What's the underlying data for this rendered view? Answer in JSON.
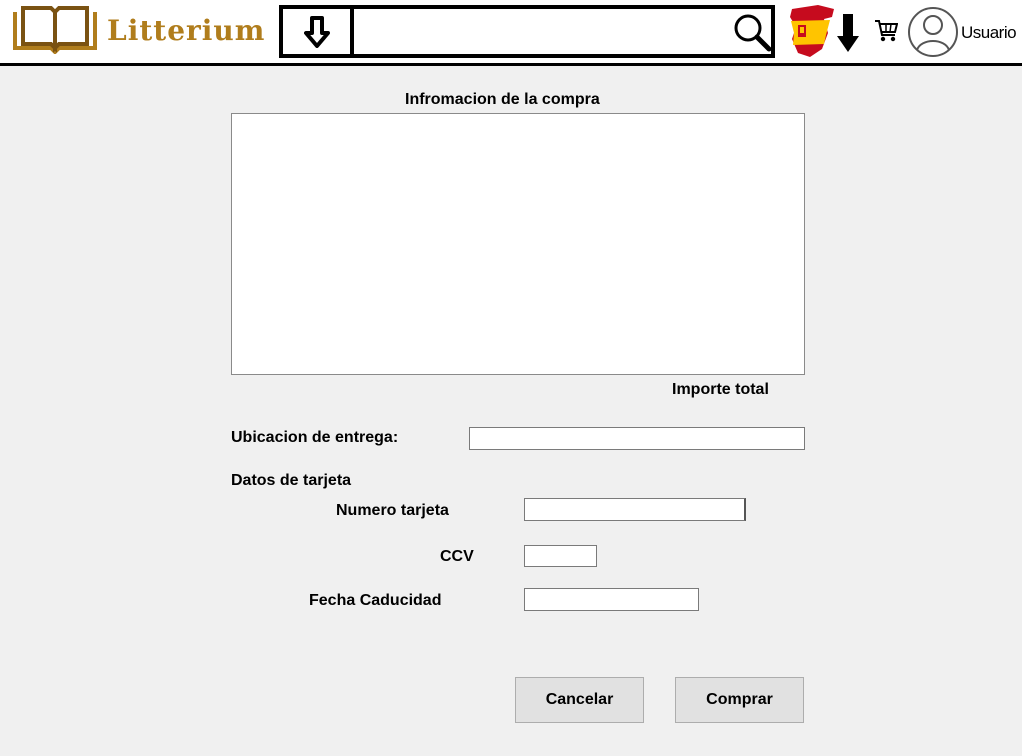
{
  "header": {
    "logo_text": "Litterium",
    "search": {
      "value": "",
      "placeholder": ""
    },
    "user_label": "Usuario"
  },
  "purchase": {
    "title": "Infromacion de la compra",
    "total_label": "Importe total"
  },
  "form": {
    "delivery_label": "Ubicacion de entrega:",
    "card_section_label": "Datos de tarjeta",
    "card_number_label": "Numero tarjeta",
    "ccv_label": "CCV",
    "expiry_label": "Fecha Caducidad",
    "delivery_value": "",
    "card_number_value": "",
    "ccv_value": "",
    "expiry_value": ""
  },
  "actions": {
    "cancel_label": "Cancelar",
    "buy_label": "Comprar"
  },
  "colors": {
    "logo_gold": "#b07d1c",
    "flag_red": "#c60b1e",
    "flag_yellow": "#ffc400"
  },
  "icons": [
    "book-logo-icon",
    "arrow-down-icon",
    "search-icon",
    "spain-flag-icon",
    "cart-icon",
    "user-icon"
  ]
}
